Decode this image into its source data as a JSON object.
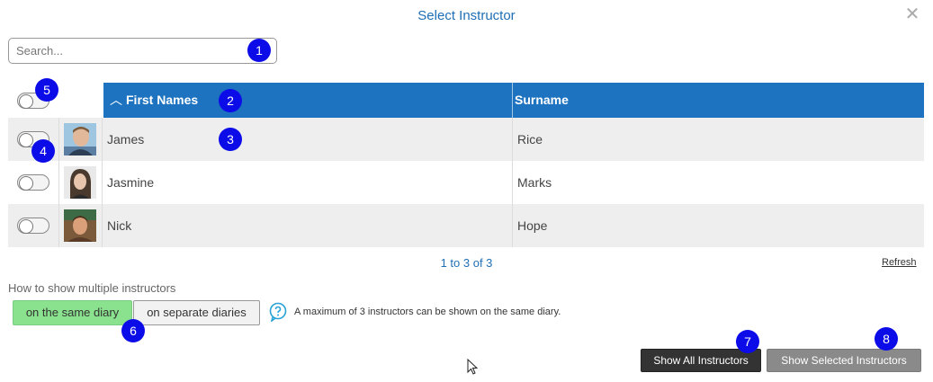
{
  "dialog": {
    "title": "Select Instructor",
    "close_icon": "close-icon"
  },
  "search": {
    "placeholder": "Search...",
    "value": ""
  },
  "table": {
    "columns": {
      "first": "First Names",
      "surname": "Surname",
      "sort_icon": "chevron-up-icon"
    },
    "rows": [
      {
        "first": "James",
        "surname": "Rice",
        "selected": false,
        "avatar": "photo-james"
      },
      {
        "first": "Jasmine",
        "surname": "Marks",
        "selected": false,
        "avatar": "photo-jasmine"
      },
      {
        "first": "Nick",
        "surname": "Hope",
        "selected": false,
        "avatar": "photo-nick"
      }
    ]
  },
  "pager": {
    "text": "1 to 3 of 3",
    "refresh": "Refresh"
  },
  "multi": {
    "label": "How to show multiple instructors",
    "same": "on the same diary",
    "separate": "on separate diaries",
    "note": "A maximum of 3 instructors can be shown on the same diary.",
    "help_icon": "question-bubble-icon",
    "active_color": "#8ae28e"
  },
  "actions": {
    "show_all": "Show All Instructors",
    "show_selected": "Show Selected Instructors"
  },
  "badges": [
    "1",
    "2",
    "3",
    "4",
    "5",
    "6",
    "7",
    "8"
  ],
  "colors": {
    "header": "#1d73c0",
    "title": "#1f6fb5",
    "badge": "#0c0ce8"
  }
}
